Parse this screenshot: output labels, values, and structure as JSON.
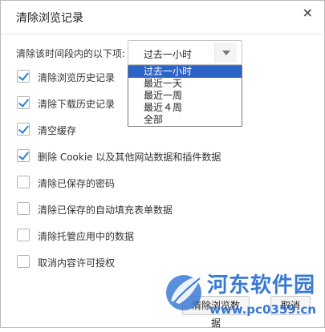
{
  "dialog": {
    "title": "清除浏览记录",
    "close_glyph": "×"
  },
  "time_range": {
    "label": "清除该时间段内的以下项:",
    "selected": "过去一小时",
    "options": [
      "过去一小时",
      "最近一天",
      "最近一周",
      "最近４周",
      "全部"
    ],
    "highlighted_index": 0
  },
  "options": [
    {
      "label": "清除浏览历史记录",
      "checked": true
    },
    {
      "label": "清除下载历史记录",
      "checked": true
    },
    {
      "label": "清空缓存",
      "checked": true
    },
    {
      "label": "删除 Cookie 以及其他网站数据和插件数据",
      "checked": true
    },
    {
      "label": "清除已保存的密码",
      "checked": false
    },
    {
      "label": "清除已保存的自动填充表单数据",
      "checked": false
    },
    {
      "label": "清除托管应用中的数据",
      "checked": false
    },
    {
      "label": "取消内容许可授权",
      "checked": false
    }
  ],
  "buttons": {
    "clear_label": "清除浏览数据",
    "cancel_label": "取消"
  },
  "watermark": {
    "title": "河东软件园",
    "url": "www.pc0359.cn",
    "logo_icon": "leaf-logo-icon"
  },
  "colors": {
    "accent": "#2d7fd4",
    "selection": "#2b63c7",
    "watermark": "#2a6fd1"
  }
}
